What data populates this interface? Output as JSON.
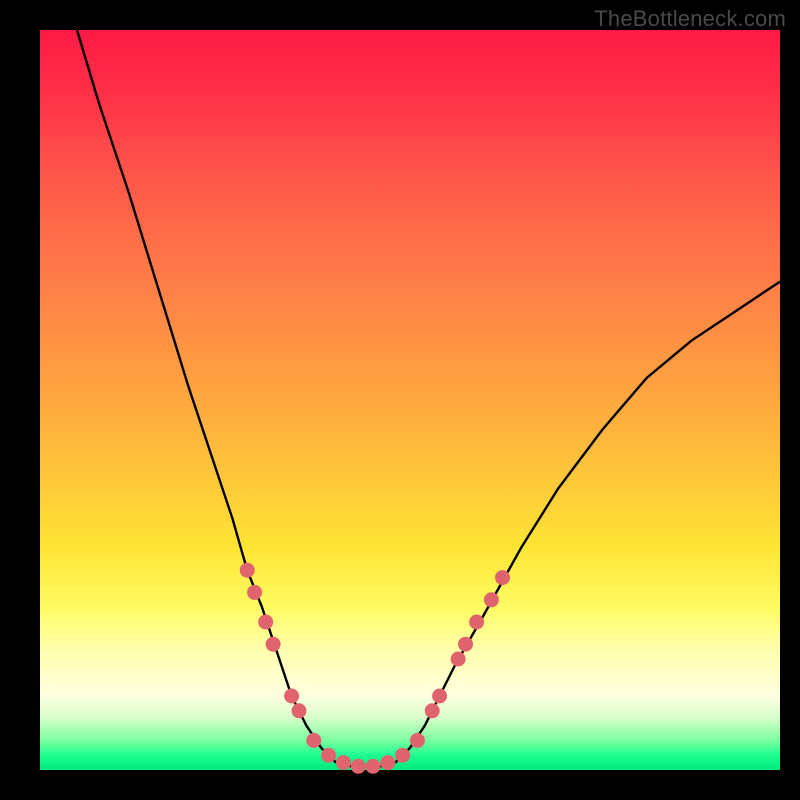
{
  "watermark": "TheBottleneck.com",
  "chart_data": {
    "type": "line",
    "title": "",
    "xlabel": "",
    "ylabel": "",
    "xlim": [
      0,
      100
    ],
    "ylim": [
      0,
      100
    ],
    "grid": false,
    "legend": false,
    "background_gradient": {
      "direction": "vertical",
      "stops": [
        {
          "pos": 0,
          "color": "#ff1a46"
        },
        {
          "pos": 34,
          "color": "#ff7d48"
        },
        {
          "pos": 70,
          "color": "#ffe534"
        },
        {
          "pos": 90,
          "color": "#ffffe0"
        },
        {
          "pos": 100,
          "color": "#00e97e"
        }
      ]
    },
    "series": [
      {
        "name": "left-branch",
        "x": [
          5,
          8,
          12,
          16,
          20,
          24,
          26,
          28,
          30,
          32,
          34,
          36,
          38,
          40
        ],
        "y": [
          100,
          90,
          78,
          65,
          52,
          40,
          34,
          27,
          22,
          16,
          10,
          6,
          3,
          1
        ]
      },
      {
        "name": "bottom-flat",
        "x": [
          40,
          42,
          44,
          46,
          48
        ],
        "y": [
          1,
          0.5,
          0.5,
          0.5,
          1
        ]
      },
      {
        "name": "right-branch",
        "x": [
          48,
          50,
          52,
          54,
          56,
          60,
          65,
          70,
          76,
          82,
          88,
          94,
          100
        ],
        "y": [
          1,
          3,
          6,
          10,
          14,
          21,
          30,
          38,
          46,
          53,
          58,
          62,
          66
        ]
      }
    ],
    "markers": {
      "name": "highlight-dots",
      "color": "#e0646e",
      "points": [
        {
          "x": 28,
          "y": 27
        },
        {
          "x": 29,
          "y": 24
        },
        {
          "x": 30.5,
          "y": 20
        },
        {
          "x": 31.5,
          "y": 17
        },
        {
          "x": 34,
          "y": 10
        },
        {
          "x": 35,
          "y": 8
        },
        {
          "x": 37,
          "y": 4
        },
        {
          "x": 39,
          "y": 2
        },
        {
          "x": 41,
          "y": 1
        },
        {
          "x": 43,
          "y": 0.5
        },
        {
          "x": 45,
          "y": 0.5
        },
        {
          "x": 47,
          "y": 1
        },
        {
          "x": 49,
          "y": 2
        },
        {
          "x": 51,
          "y": 4
        },
        {
          "x": 53,
          "y": 8
        },
        {
          "x": 54,
          "y": 10
        },
        {
          "x": 56.5,
          "y": 15
        },
        {
          "x": 57.5,
          "y": 17
        },
        {
          "x": 59,
          "y": 20
        },
        {
          "x": 61,
          "y": 23
        },
        {
          "x": 62.5,
          "y": 26
        }
      ]
    }
  }
}
